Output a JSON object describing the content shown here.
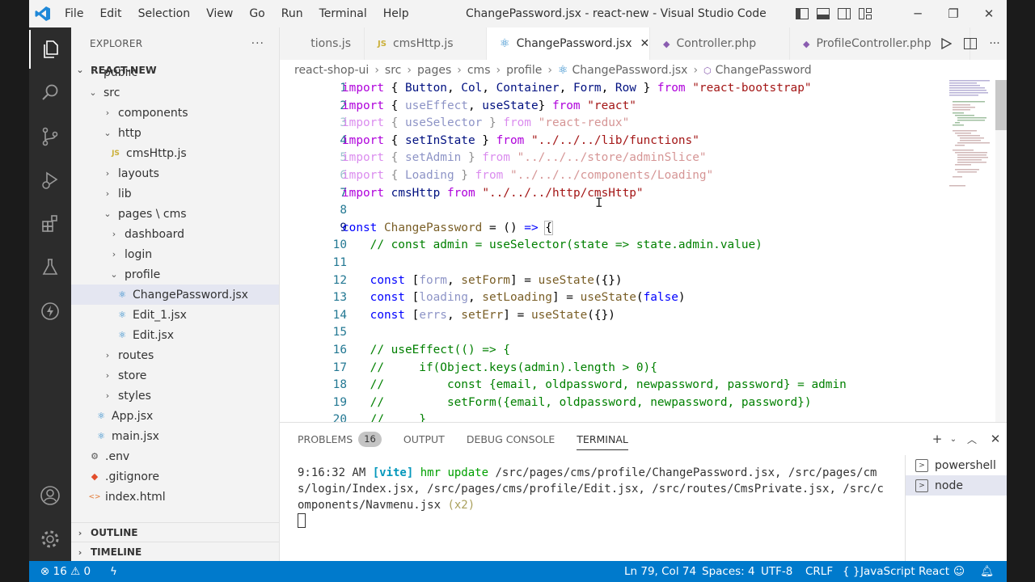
{
  "window": {
    "title": "ChangePassword.jsx - react-new - Visual Studio Code",
    "menu": [
      "File",
      "Edit",
      "Selection",
      "View",
      "Go",
      "Run",
      "Terminal",
      "Help"
    ],
    "controls": {
      "minimize": "─",
      "restore": "❐",
      "close": "✕"
    }
  },
  "activity_bar": {
    "items": [
      "explorer-icon",
      "search-icon",
      "source-control-icon",
      "run-debug-icon",
      "extensions-icon",
      "testing-icon",
      "remote-icon"
    ],
    "bottom": [
      "account-icon",
      "settings-gear-icon"
    ]
  },
  "sidebar": {
    "title": "EXPLORER",
    "more": "···",
    "project": "REACT-NEW",
    "tree": [
      {
        "label": "public",
        "chev": "›",
        "icon": ""
      },
      {
        "label": "src",
        "chev": "⌄",
        "icon": ""
      },
      {
        "label": "components",
        "chev": "›",
        "icon": ""
      },
      {
        "label": "http",
        "chev": "⌄",
        "icon": ""
      },
      {
        "label": "cmsHttp.js",
        "chev": "",
        "icon": "JS"
      },
      {
        "label": "layouts",
        "chev": "›",
        "icon": ""
      },
      {
        "label": "lib",
        "chev": "›",
        "icon": ""
      },
      {
        "label": "pages \\ cms",
        "chev": "⌄",
        "icon": ""
      },
      {
        "label": "dashboard",
        "chev": "›",
        "icon": ""
      },
      {
        "label": "login",
        "chev": "›",
        "icon": ""
      },
      {
        "label": "profile",
        "chev": "⌄",
        "icon": ""
      },
      {
        "label": "ChangePassword.jsx",
        "chev": "",
        "icon": "⚛"
      },
      {
        "label": "Edit_1.jsx",
        "chev": "",
        "icon": "⚛"
      },
      {
        "label": "Edit.jsx",
        "chev": "",
        "icon": "⚛"
      },
      {
        "label": "routes",
        "chev": "›",
        "icon": ""
      },
      {
        "label": "store",
        "chev": "›",
        "icon": ""
      },
      {
        "label": "styles",
        "chev": "›",
        "icon": ""
      },
      {
        "label": "App.jsx",
        "chev": "",
        "icon": "⚛"
      },
      {
        "label": "main.jsx",
        "chev": "",
        "icon": "⚛"
      },
      {
        "label": ".env",
        "chev": "",
        "icon": "⚙"
      },
      {
        "label": ".gitignore",
        "chev": "",
        "icon": "◆"
      },
      {
        "label": "index.html",
        "chev": "",
        "icon": "<>"
      }
    ],
    "outline": "OUTLINE",
    "timeline": "TIMELINE"
  },
  "tabs": [
    {
      "label": "tions.js",
      "icon": ""
    },
    {
      "label": "cmsHttp.js",
      "icon": "JS"
    },
    {
      "label": "ChangePassword.jsx",
      "icon": "⚛",
      "close": "✕"
    },
    {
      "label": "Controller.php",
      "icon": "php"
    },
    {
      "label": "ProfileController.php",
      "icon": "php"
    }
  ],
  "breadcrumb": [
    "react-shop-ui",
    "src",
    "pages",
    "cms",
    "profile",
    "ChangePassword.jsx",
    "ChangePassword"
  ],
  "code": {
    "line_numbers": [
      "1",
      "2",
      "3",
      "4",
      "5",
      "6",
      "7",
      "8",
      "9",
      "10",
      "11",
      "12",
      "13",
      "14",
      "15",
      "16",
      "17",
      "18",
      "19",
      "20"
    ],
    "current_line": 9
  },
  "panel": {
    "tabs": [
      "PROBLEMS",
      "OUTPUT",
      "DEBUG CONSOLE",
      "TERMINAL"
    ],
    "problems_count": "16",
    "terminal": {
      "time": "9:16:32 AM ",
      "tag": "[vite]",
      "event": " hmr update ",
      "paths": "/src/pages/cms/profile/ChangePassword.jsx, /src/pages/cms/login/Index.jsx, /src/pages/cms/profile/Edit.jsx, /src/routes/CmsPrivate.jsx, /src/components/Navmenu.jsx",
      "count": " (x2)"
    },
    "terminals": [
      "powershell",
      "node"
    ]
  },
  "status": {
    "errors": "16",
    "warnings": "0",
    "position": "Ln 79, Col 74",
    "spaces": "Spaces: 4",
    "encoding": "UTF-8",
    "eol": "CRLF",
    "language": "JavaScript React"
  },
  "colors": {
    "accent": "#007acc",
    "activity_bg": "#2c2c2c",
    "selection": "#e4e6f1"
  }
}
